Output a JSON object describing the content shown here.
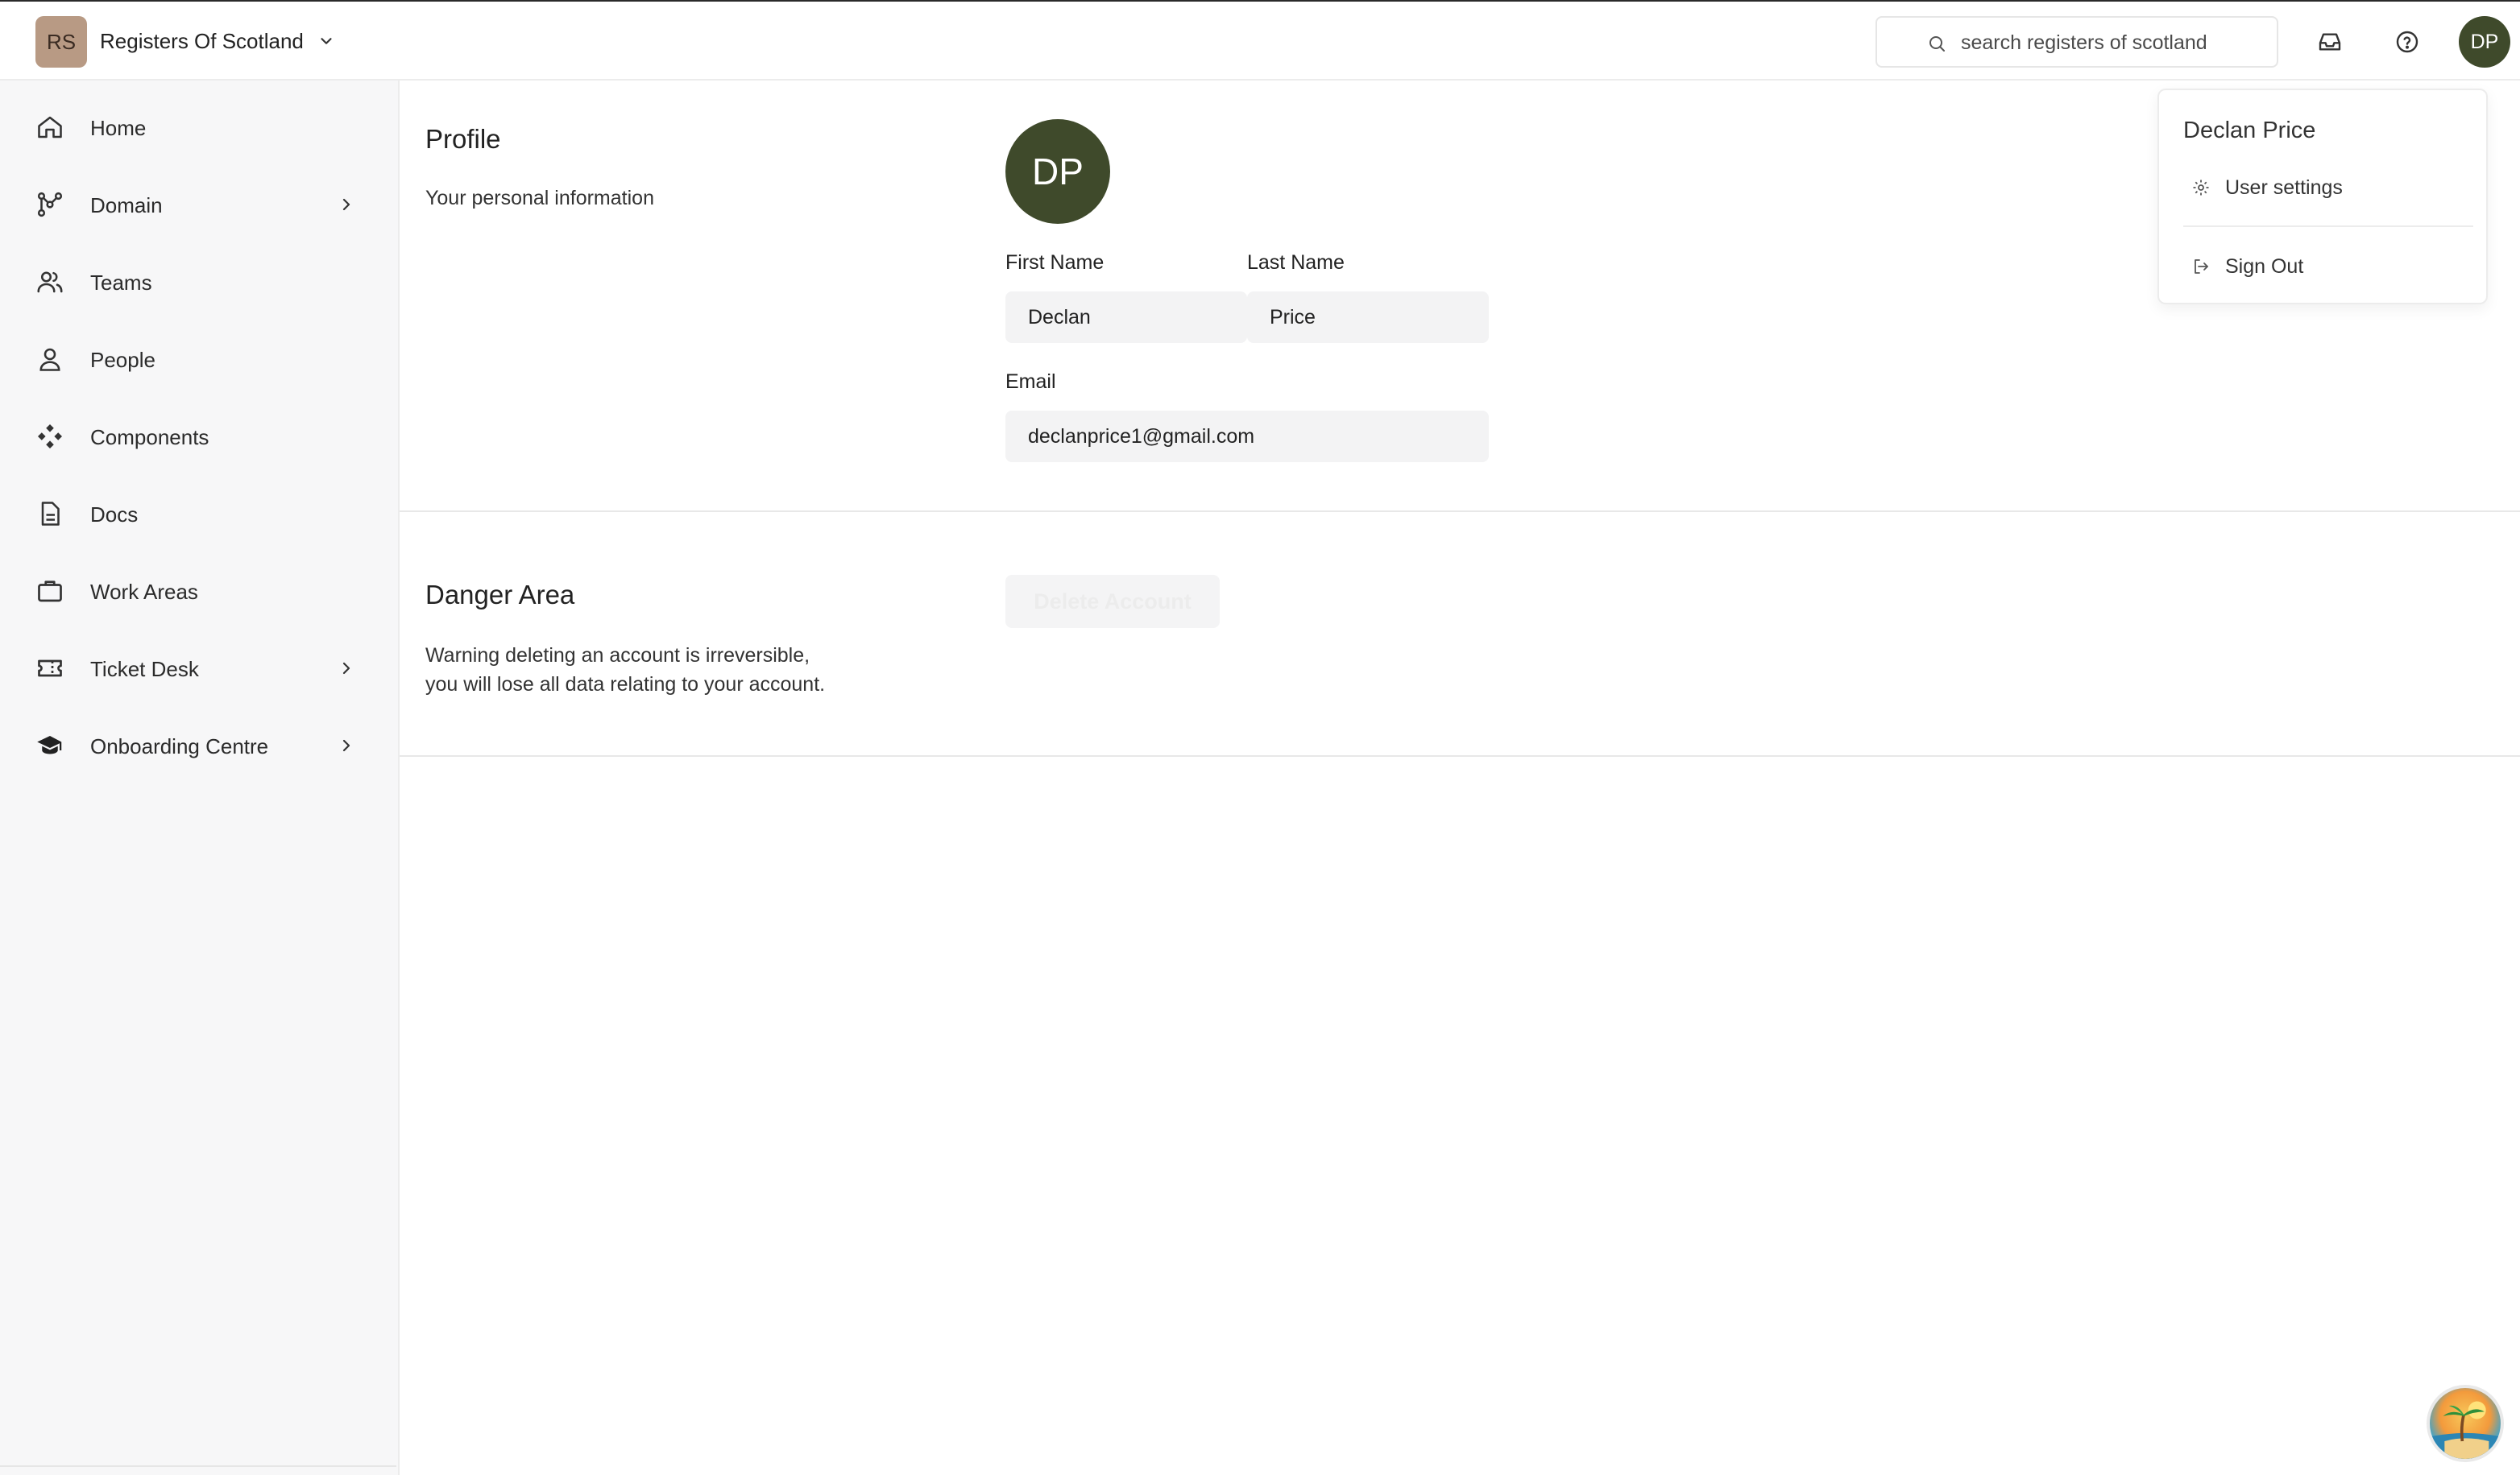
{
  "header": {
    "org_initials": "RS",
    "org_name": "Registers Of Scotland",
    "search_placeholder": "search registers of scotland",
    "user_initials": "DP"
  },
  "sidebar": {
    "items": [
      {
        "label": "Home",
        "icon": "home-icon",
        "has_submenu": false
      },
      {
        "label": "Domain",
        "icon": "domain-icon",
        "has_submenu": true
      },
      {
        "label": "Teams",
        "icon": "teams-icon",
        "has_submenu": false
      },
      {
        "label": "People",
        "icon": "person-icon",
        "has_submenu": false
      },
      {
        "label": "Components",
        "icon": "components-icon",
        "has_submenu": false
      },
      {
        "label": "Docs",
        "icon": "document-icon",
        "has_submenu": false
      },
      {
        "label": "Work Areas",
        "icon": "briefcase-icon",
        "has_submenu": false
      },
      {
        "label": "Ticket Desk",
        "icon": "ticket-icon",
        "has_submenu": true
      },
      {
        "label": "Onboarding Centre",
        "icon": "graduation-cap-icon",
        "has_submenu": true
      }
    ]
  },
  "profile": {
    "title": "Profile",
    "description": "Your personal information",
    "avatar_initials": "DP",
    "first_name_label": "First Name",
    "first_name_value": "Declan",
    "last_name_label": "Last Name",
    "last_name_value": "Price",
    "email_label": "Email",
    "email_value": "declanprice1@gmail.com"
  },
  "danger": {
    "title": "Danger Area",
    "warning_line1": "Warning deleting an account is irreversible,",
    "warning_line2": "you will lose all data relating to your account.",
    "delete_label": "Delete Account"
  },
  "user_menu": {
    "name": "Declan Price",
    "settings_label": "User settings",
    "signout_label": "Sign Out"
  },
  "colors": {
    "avatar_bg": "#3f4a2b",
    "org_badge_bg": "#b89a84",
    "sidebar_bg": "#f7f7f8",
    "field_bg": "#f3f3f4"
  }
}
